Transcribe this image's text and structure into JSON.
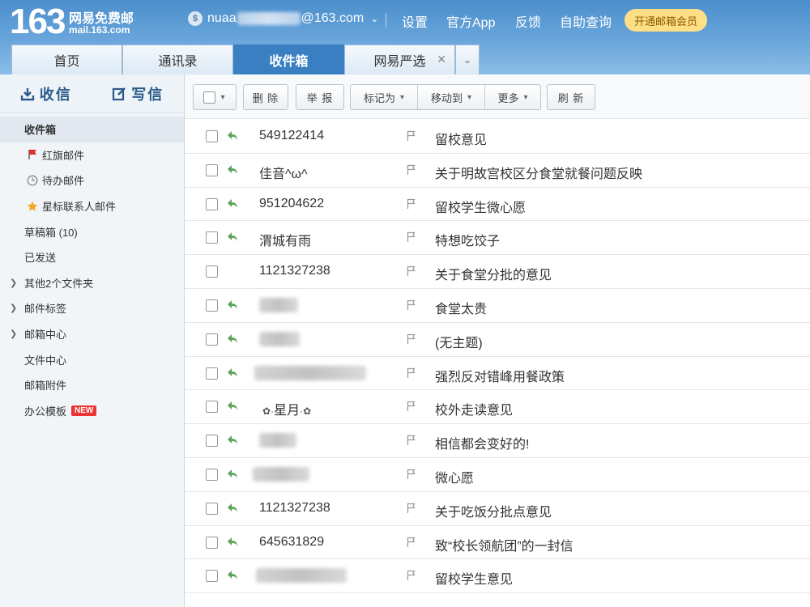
{
  "header": {
    "logo_number": "163",
    "logo_name": "网易免费邮",
    "logo_url": "mail.163.com",
    "account_prefix": "nuaa",
    "account_suffix": "@163.com",
    "links": [
      "设置",
      "官方App",
      "反馈",
      "自助查询"
    ],
    "vip_label": "开通邮箱会员"
  },
  "tabs": [
    {
      "label": "首页"
    },
    {
      "label": "通讯录"
    },
    {
      "label": "收件箱"
    },
    {
      "label": "网易严选"
    }
  ],
  "sidebar": {
    "receive_label": "收信",
    "compose_label": "写信",
    "items": [
      {
        "label": "收件箱"
      },
      {
        "label": "红旗邮件"
      },
      {
        "label": "待办邮件"
      },
      {
        "label": "星标联系人邮件"
      },
      {
        "label": "草稿箱 (10)"
      },
      {
        "label": "已发送"
      },
      {
        "label": "其他2个文件夹"
      },
      {
        "label": "邮件标签"
      },
      {
        "label": "邮箱中心"
      },
      {
        "label": "文件中心"
      },
      {
        "label": "邮箱附件"
      },
      {
        "label": "办公模板"
      }
    ],
    "new_badge": "NEW"
  },
  "toolbar": {
    "delete": "删 除",
    "report": "举 报",
    "mark_as": "标记为",
    "move_to": "移动到",
    "more": "更多",
    "refresh": "刷 新"
  },
  "emails": [
    {
      "sender": "549122414",
      "subject": "留校意见"
    },
    {
      "sender": "佳音^ω^",
      "subject": "关于明故宫校区分食堂就餐问题反映"
    },
    {
      "sender": "951204622",
      "subject": "留校学生微心愿"
    },
    {
      "sender": "渭城有雨",
      "subject": "特想吃饺子"
    },
    {
      "sender": "1121327238",
      "subject": "关于食堂分批的意见"
    },
    {
      "sender": "",
      "subject": "食堂太贵"
    },
    {
      "sender": "",
      "subject": "(无主题)"
    },
    {
      "sender": "",
      "subject": "强烈反对错峰用餐政策"
    },
    {
      "sender": "星月",
      "subject": "校外走读意见"
    },
    {
      "sender": "",
      "subject": "相信都会变好的!"
    },
    {
      "sender": "",
      "subject": "微心愿"
    },
    {
      "sender": "1121327238",
      "subject": "关于吃饭分批点意见"
    },
    {
      "sender": "645631829",
      "subject": "致“校长领航团”的一封信"
    },
    {
      "sender": "",
      "subject": "留校学生意见"
    }
  ],
  "colors": {
    "header_blue": "#4b8ecb",
    "tab_active": "#3a7fc1",
    "reply_green": "#5aa55a",
    "flag_red": "#d9312b",
    "star_orange": "#f5a623"
  }
}
